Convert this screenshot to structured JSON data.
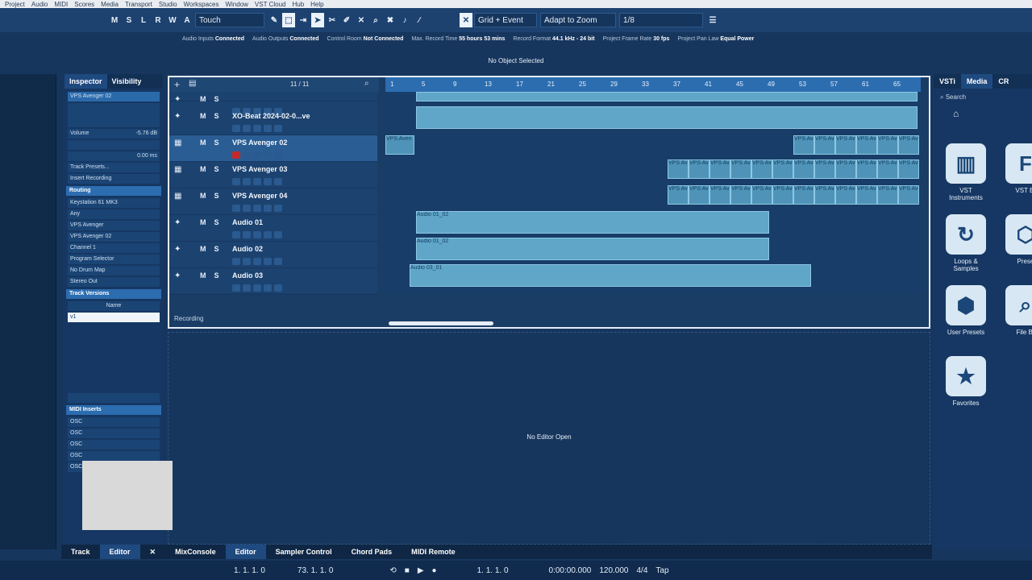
{
  "menu": [
    "Project",
    "Audio",
    "MIDI",
    "Scores",
    "Media",
    "Transport",
    "Studio",
    "Workspaces",
    "Window",
    "VST Cloud",
    "Hub",
    "Help"
  ],
  "toolbar": {
    "buttons": [
      "M",
      "S",
      "L",
      "R",
      "W",
      "A"
    ],
    "automation_mode": "Touch",
    "snap_type": "Grid + Event",
    "zoom": "Adapt to Zoom",
    "quantize": "1/8"
  },
  "status": [
    {
      "label": "Audio Inputs",
      "value": "Connected"
    },
    {
      "label": "Audio Outputs",
      "value": "Connected"
    },
    {
      "label": "Control Room",
      "value": "Not Connected"
    },
    {
      "label": "Max. Record Time",
      "value": "55 hours 53 mins"
    },
    {
      "label": "Record Format",
      "value": "44.1 kHz - 24 bit"
    },
    {
      "label": "Project Frame Rate",
      "value": "30 fps"
    },
    {
      "label": "Project Pan Law",
      "value": "Equal Power"
    }
  ],
  "info_line": "No Object Selected",
  "inspector": {
    "tabs": [
      "Inspector",
      "Visibility"
    ],
    "track_name": "VPS Avenger 02",
    "volume": "-5.76 dB",
    "delay": "0.00 ms",
    "track_presets": "Track Presets...",
    "insert_recording": "Insert Recording",
    "routing_title": "Routing",
    "routing": [
      "Keystation 61 MK3",
      "Any",
      "VPS Avenger",
      "VPS Avenger 02",
      "Channel 1",
      "Program Selector",
      "No Drum Map",
      "Stereo Out"
    ],
    "track_versions": "Track Versions",
    "tv_header": "Name",
    "tv_item": "v1",
    "midi_inserts": "MIDI Inserts",
    "osc": [
      "OSC",
      "OSC",
      "OSC",
      "OSC",
      "OSC1 Transpose"
    ]
  },
  "project": {
    "track_count": "11 / 11",
    "ruler": [
      "1",
      "5",
      "9",
      "13",
      "17",
      "21",
      "25",
      "29",
      "33",
      "37",
      "41",
      "45",
      "49",
      "53",
      "57",
      "61",
      "65"
    ],
    "tracks": [
      {
        "name": "",
        "type": "folder"
      },
      {
        "name": "XO-Beat 2024-02-0...ve",
        "type": "beat"
      },
      {
        "name": "VPS Avenger 02",
        "type": "instrument",
        "selected": true
      },
      {
        "name": "VPS Avenger 03",
        "type": "instrument"
      },
      {
        "name": "VPS Avenger 04",
        "type": "instrument"
      },
      {
        "name": "Audio 01",
        "type": "audio"
      },
      {
        "name": "Audio 02",
        "type": "audio"
      },
      {
        "name": "Audio 03",
        "type": "audio"
      }
    ],
    "clip_labels": {
      "vps": "VPS Aven",
      "vps02": "VPS Aven",
      "audio01a": "Audio 01_02",
      "audio01b": "Audio 01",
      "audio01c": "Audio 01_02",
      "audio02a": "Audio 01_02",
      "audio02b": "Audio 01_02",
      "audio03a": "Audio 03",
      "audio03b": "Audio 03_01"
    },
    "recording_label": "Recording"
  },
  "editor_text": "No Editor Open",
  "media": {
    "tabs": [
      "VSTi",
      "Media",
      "CR"
    ],
    "search_placeholder": "Search",
    "tiles": [
      "VST Instruments",
      "VST Ef",
      "Loops & Samples",
      "Prese",
      "User Presets",
      "File Br",
      "Favorites"
    ]
  },
  "lower_tabs": [
    "Track",
    "Editor",
    "MixConsole",
    "Editor",
    "Sampler Control",
    "Chord Pads",
    "MIDI Remote"
  ],
  "transport": {
    "left_locator": "1. 1. 1. 0",
    "right_locator": "73. 1. 1. 0",
    "position": "1. 1. 1. 0",
    "time": "0:00:00.000",
    "tempo": "120.000",
    "signature": "4/4",
    "tap": "Tap"
  }
}
